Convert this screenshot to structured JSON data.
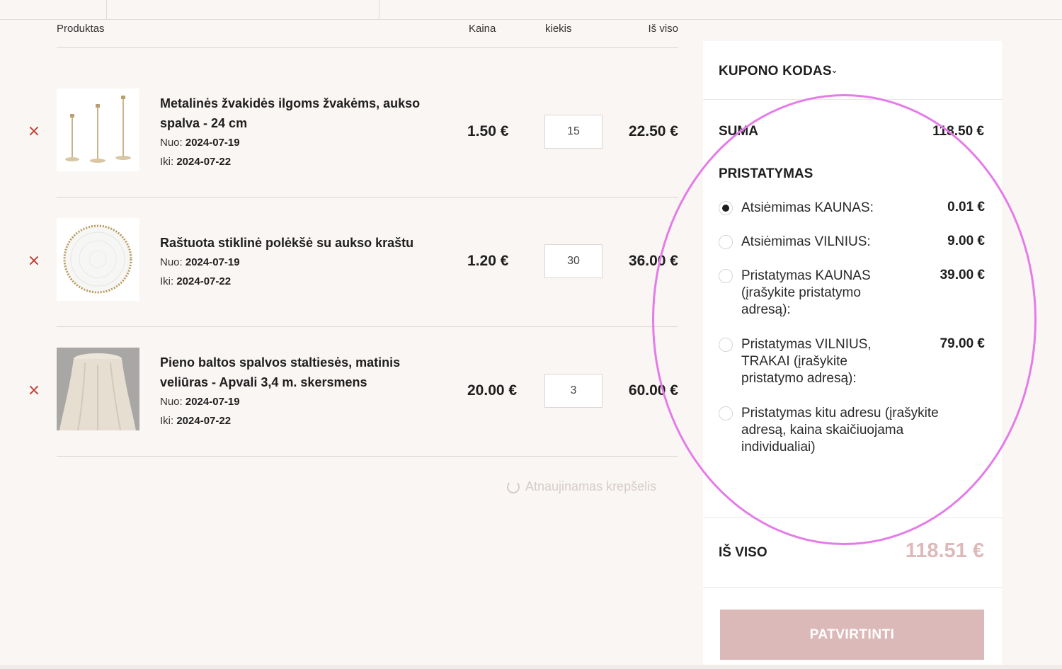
{
  "table": {
    "headers": {
      "product": "Produktas",
      "price": "Kaina",
      "qty": "kiekis",
      "total": "Iš viso"
    },
    "rows": [
      {
        "name_line1": "Metalinės žvakidės ilgoms žvakėms, aukso",
        "name_line2": "spalva - 24 cm",
        "from_label": "Nuo:",
        "from": "2024-07-19",
        "to_label": "Iki:",
        "to": "2024-07-22",
        "price": "1.50 €",
        "qty": "15",
        "total": "22.50 €"
      },
      {
        "name_line1": "Raštuota stiklinė polėkšė su aukso kraštu",
        "name_line2": "",
        "from_label": "Nuo:",
        "from": "2024-07-19",
        "to_label": "Iki:",
        "to": "2024-07-22",
        "price": "1.20 €",
        "qty": "30",
        "total": "36.00 €"
      },
      {
        "name_line1": "Pieno baltos spalvos staltiesės, matinis",
        "name_line2": "veliūras - Apvali 3,4 m. skersmens",
        "from_label": "Nuo:",
        "from": "2024-07-19",
        "to_label": "Iki:",
        "to": "2024-07-22",
        "price": "20.00 €",
        "qty": "3",
        "total": "60.00 €"
      }
    ],
    "remove_icon": "×",
    "refresh_text": "Atnaujinamas krepšelis"
  },
  "sidebar": {
    "coupon_label": "KUPONO KODAS",
    "coupon_chevron": "⌄",
    "suma_label": "SUMA",
    "suma_value": "118.50 €",
    "shipping_title": "PRISTATYMAS",
    "options": [
      {
        "label": "Atsiėmimas KAUNAS:",
        "price": "0.01 €",
        "selected": true
      },
      {
        "label": "Atsiėmimas VILNIUS:",
        "price": "9.00 €",
        "selected": false
      },
      {
        "label": "Pristatymas KAUNAS (įrašykite pristatymo adresą):",
        "price": "39.00 €",
        "selected": false
      },
      {
        "label": "Pristatymas VILNIUS, TRAKAI (įrašykite pristatymo adresą):",
        "price": "79.00 €",
        "selected": false
      },
      {
        "label": "Pristatymas kitu adresu (įrašykite adresą, kaina skaičiuojama individualiai)",
        "price": "",
        "selected": false
      }
    ],
    "total_label": "IŠ VISO",
    "total_value": "118.51 €",
    "confirm_label": "PATVIRTINTI"
  },
  "colors": {
    "background": "#faf6f4",
    "accent_pink": "#dcb9b9",
    "remove_red": "#c0392b",
    "annotation": "#e47ce8"
  }
}
